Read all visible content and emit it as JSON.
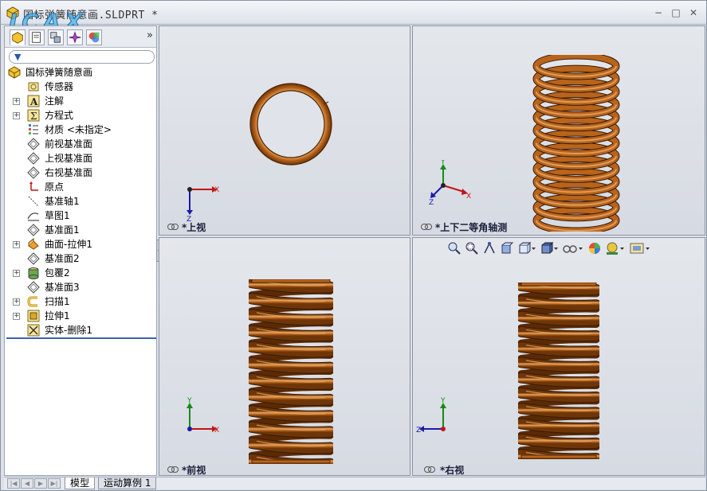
{
  "window": {
    "title": "国标弹簧随意画.SLDPRT *",
    "watermark_text": "ICAX",
    "watermark_url": "WWW.ICAX.CN",
    "controls": {
      "minimize": "−",
      "restore": "□",
      "close": "✕"
    }
  },
  "feature_manager": {
    "more": "»",
    "filter_icon": "filter-icon",
    "root": "国标弹簧随意画",
    "items": [
      {
        "label": "传感器",
        "icon": "sensor-icon",
        "expandable": false
      },
      {
        "label": "注解",
        "icon": "annotation-icon",
        "expandable": true
      },
      {
        "label": "方程式",
        "icon": "equation-icon",
        "expandable": true
      },
      {
        "label": "材质 <未指定>",
        "icon": "material-icon",
        "expandable": false
      },
      {
        "label": "前视基准面",
        "icon": "plane-icon",
        "expandable": false
      },
      {
        "label": "上视基准面",
        "icon": "plane-icon",
        "expandable": false
      },
      {
        "label": "右视基准面",
        "icon": "plane-icon",
        "expandable": false
      },
      {
        "label": "原点",
        "icon": "origin-icon",
        "expandable": false
      },
      {
        "label": "基准轴1",
        "icon": "axis-icon",
        "expandable": false
      },
      {
        "label": "草图1",
        "icon": "sketch-icon",
        "expandable": false
      },
      {
        "label": "基准面1",
        "icon": "plane-icon",
        "expandable": false
      },
      {
        "label": "曲面-拉伸1",
        "icon": "surface-extrude-icon",
        "expandable": true
      },
      {
        "label": "基准面2",
        "icon": "plane-icon",
        "expandable": false
      },
      {
        "label": "包覆2",
        "icon": "wrap-icon",
        "expandable": true
      },
      {
        "label": "基准面3",
        "icon": "plane-icon",
        "expandable": false
      },
      {
        "label": "扫描1",
        "icon": "sweep-icon",
        "expandable": true
      },
      {
        "label": "拉伸1",
        "icon": "extrude-icon",
        "expandable": true
      },
      {
        "label": "实体-删除1",
        "icon": "delete-body-icon",
        "expandable": false
      }
    ]
  },
  "viewports": {
    "top": {
      "label": "*上视"
    },
    "iso": {
      "label": "*上下二等角轴测"
    },
    "front": {
      "label": "*前视"
    },
    "right": {
      "label": "*右视"
    }
  },
  "axes": {
    "x": "X",
    "y": "Y",
    "z": "Z"
  },
  "view_toolbar": [
    "zoom-fit-icon",
    "zoom-area-icon",
    "previous-view-icon",
    "section-view-icon",
    "view-orientation-icon",
    "display-style-icon",
    "hide-show-icon",
    "appearance-icon",
    "scene-icon",
    "view-settings-icon"
  ],
  "bottom_tabs": {
    "model": "模型",
    "motion": "运动算例 1"
  },
  "colors": {
    "spring": "#b8641c",
    "spring_dark": "#6e3608",
    "spring_light": "#e8a560",
    "selection": "#3b64b1"
  }
}
